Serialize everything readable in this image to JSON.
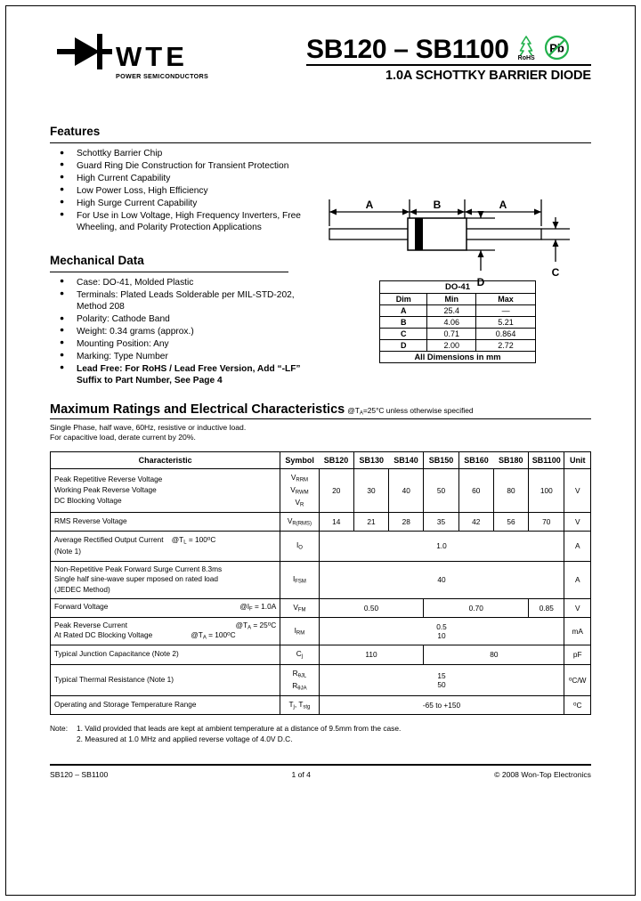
{
  "header": {
    "logo_text": "WTE",
    "logo_sub": "POWER SEMICONDUCTORS",
    "title": "SB120 – SB1100",
    "subtitle": "1.0A SCHOTTKY BARRIER DIODE",
    "rohs_label": "RoHS",
    "pb_label": "Pb",
    "rohs_color": "#22B14C",
    "pb_color": "#22B14C"
  },
  "features": {
    "heading": "Features",
    "items": [
      "Schottky Barrier Chip",
      "Guard Ring Die Construction for Transient Protection",
      "High Current Capability",
      "Low Power Loss, High Efficiency",
      "High Surge Current Capability",
      "For Use in Low Voltage, High Frequency Inverters, Free Wheeling, and Polarity Protection Applications"
    ]
  },
  "mechanical": {
    "heading": "Mechanical Data",
    "items": [
      {
        "text": "Case: DO-41, Molded Plastic",
        "bold": false
      },
      {
        "text": "Terminals: Plated Leads Solderable per MIL-STD-202, Method 208",
        "bold": false
      },
      {
        "text": "Polarity: Cathode Band",
        "bold": false
      },
      {
        "text": "Weight: 0.34 grams (approx.)",
        "bold": false
      },
      {
        "text": "Mounting Position: Any",
        "bold": false
      },
      {
        "text": "Marking: Type Number",
        "bold": false
      },
      {
        "text": "Lead Free: For RoHS / Lead Free Version, Add “-LF” Suffix to Part Number, See Page 4",
        "bold": true
      }
    ]
  },
  "package_drawing": {
    "labels": {
      "a_left": "A",
      "b": "B",
      "a_right": "A",
      "c": "C",
      "d": "D"
    }
  },
  "dim_table": {
    "title": "DO-41",
    "headers": [
      "Dim",
      "Min",
      "Max"
    ],
    "rows": [
      [
        "A",
        "25.4",
        "—"
      ],
      [
        "B",
        "4.06",
        "5.21"
      ],
      [
        "C",
        "0.71",
        "0.864"
      ],
      [
        "D",
        "2.00",
        "2.72"
      ]
    ],
    "footer": "All Dimensions in mm"
  },
  "ratings": {
    "title": "Maximum Ratings and Electrical Characteristics",
    "condition_prefix": "@T",
    "condition_sub": "A",
    "condition_suffix": "=25°C unless otherwise specified",
    "note_line1": "Single Phase, half wave, 60Hz, resistive or inductive load.",
    "note_line2": "For capacitive load, derate current by 20%.",
    "columns": {
      "characteristic": "Characteristic",
      "symbol": "Symbol",
      "parts": [
        "SB120",
        "SB130",
        "SB140",
        "SB150",
        "SB160",
        "SB180",
        "SB1100"
      ],
      "unit": "Unit"
    },
    "rows": [
      {
        "characteristic_lines": [
          "Peak Repetitive Reverse Voltage",
          "Working Peak Reverse Voltage",
          "DC Blocking Voltage"
        ],
        "symbol_lines": [
          "VRRM",
          "VRWM",
          "VR"
        ],
        "values": [
          "20",
          "30",
          "40",
          "50",
          "60",
          "80",
          "100"
        ],
        "unit": "V"
      },
      {
        "characteristic_lines": [
          "RMS Reverse Voltage"
        ],
        "symbol_lines": [
          "VR(RMS)"
        ],
        "values": [
          "14",
          "21",
          "28",
          "35",
          "42",
          "56",
          "70"
        ],
        "unit": "V"
      },
      {
        "characteristic_lines": [
          "Average Rectified Output Current    @TL = 100°C",
          "(Note 1)"
        ],
        "symbol_lines": [
          "IO"
        ],
        "merged_value": "1.0",
        "unit": "A"
      },
      {
        "characteristic_lines": [
          "Non-Repetitive Peak Forward Surge Current 8.3ms",
          "Single half sine-wave super mposed on rated load",
          "(JEDEC Method)"
        ],
        "symbol_lines": [
          "IFSM"
        ],
        "merged_value": "40",
        "unit": "A"
      },
      {
        "characteristic_lines": [
          "Forward Voltage                        @IF = 1.0A"
        ],
        "symbol_lines": [
          "VFM"
        ],
        "group_values": [
          "0.50",
          "0.70",
          "0.85"
        ],
        "unit": "V"
      },
      {
        "characteristic_lines": [
          "Peak Reverse Current                 @TA = 25°C",
          "At Rated DC Blocking Voltage      @TA = 100°C"
        ],
        "symbol_lines": [
          "IRM"
        ],
        "merged_value_lines": [
          "0.5",
          "10"
        ],
        "unit": "mA"
      },
      {
        "characteristic_lines": [
          "Typical Junction Capacitance (Note 2)"
        ],
        "symbol_lines": [
          "Cj"
        ],
        "split_values": [
          "110",
          "80"
        ],
        "unit": "pF"
      },
      {
        "characteristic_lines": [
          "Typical Thermal Resistance (Note 1)"
        ],
        "symbol_lines": [
          "RθJL",
          "RθJA"
        ],
        "merged_value_lines": [
          "15",
          "50"
        ],
        "unit": "°C/W"
      },
      {
        "characteristic_lines": [
          "Operating and Storage Temperature Range"
        ],
        "symbol_lines": [
          "Tj, Tstg"
        ],
        "merged_value": "-65 to +150",
        "unit": "°C"
      }
    ]
  },
  "notes": {
    "label": "Note:",
    "items": [
      "1. Valid provided that leads are kept at ambient temperature at a distance of 9.5mm from the case.",
      "2. Measured at 1.0 MHz and applied reverse voltage of 4.0V D.C."
    ]
  },
  "footer": {
    "left": "SB120 – SB1100",
    "center": "1 of 4",
    "right": "© 2008 Won-Top Electronics"
  }
}
